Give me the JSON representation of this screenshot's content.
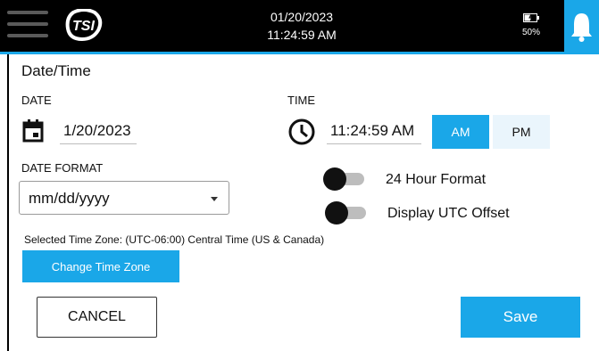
{
  "header": {
    "date": "01/20/2023",
    "time": "11:24:59 AM",
    "battery_level": "50%",
    "menu_icon": "hamburger-menu-icon",
    "logo_icon": "tsi-logo",
    "notification_icon": "bell-icon",
    "accent_color": "#1aa7e8"
  },
  "page": {
    "title": "Date/Time"
  },
  "date": {
    "label": "DATE",
    "value": "1/20/2023",
    "icon": "calendar-icon"
  },
  "time": {
    "label": "TIME",
    "value": "11:24:59 AM",
    "icon": "clock-icon",
    "am_label": "AM",
    "pm_label": "PM",
    "selected": "AM"
  },
  "date_format": {
    "label": "DATE FORMAT",
    "value": "mm/dd/yyyy"
  },
  "toggles": [
    {
      "label": "24 Hour Format",
      "on": false
    },
    {
      "label": "Display UTC Offset",
      "on": false
    }
  ],
  "timezone": {
    "text": "Selected Time Zone: (UTC-06:00) Central Time (US & Canada)",
    "button": "Change Time Zone"
  },
  "actions": {
    "cancel": "CANCEL",
    "save": "Save"
  }
}
